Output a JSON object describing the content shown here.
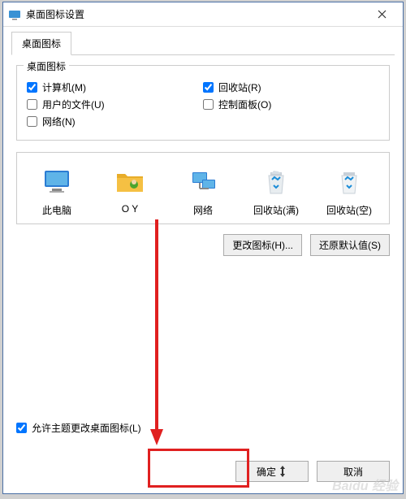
{
  "window": {
    "title": "桌面图标设置"
  },
  "tabs": {
    "active": "桌面图标"
  },
  "fieldset": {
    "legend": "桌面图标"
  },
  "checks": {
    "computer": "计算机(M)",
    "recycle": "回收站(R)",
    "userfiles": "用户的文件(U)",
    "control": "控制面板(O)",
    "network": "网络(N)"
  },
  "icons": {
    "thispc": "此电脑",
    "oy": "O Y",
    "net": "网络",
    "recycle_full": "回收站(满)",
    "recycle_empty": "回收站(空)"
  },
  "buttons": {
    "change": "更改图标(H)...",
    "restore": "还原默认值(S)",
    "ok": "确定",
    "cancel": "取消"
  },
  "allow_theme": "允许主题更改桌面图标(L)",
  "watermark": "Baidu 经验"
}
